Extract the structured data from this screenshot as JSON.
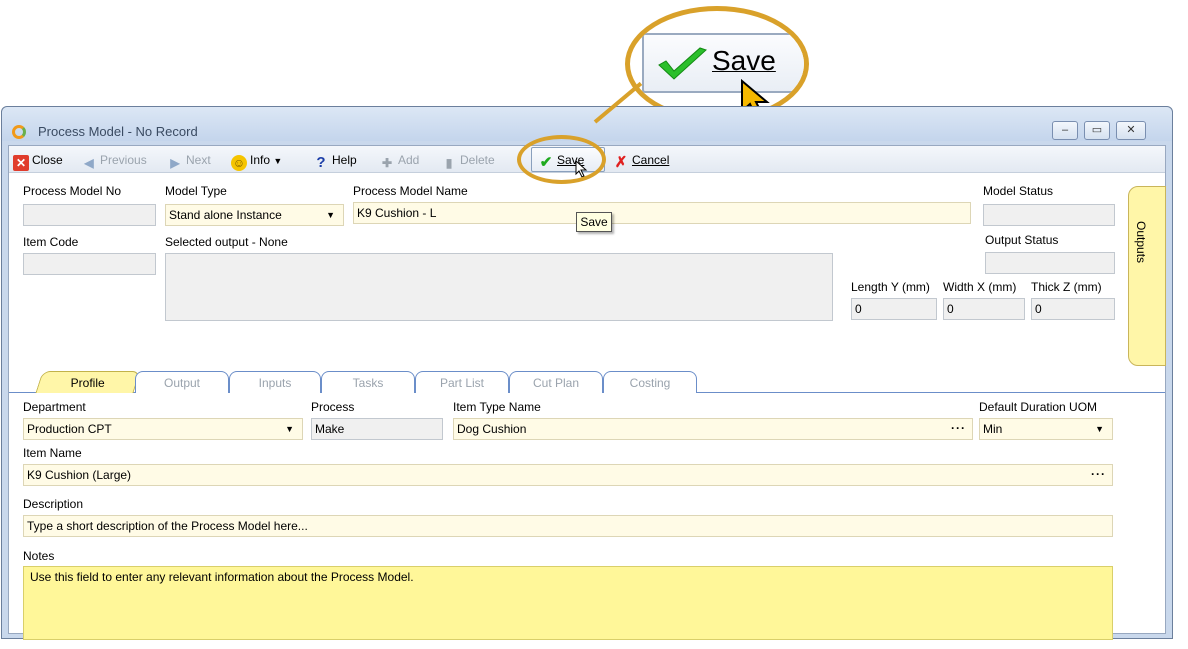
{
  "window": {
    "title": "Process Model - No Record"
  },
  "toolbar": {
    "close": "Close",
    "previous": "Previous",
    "next": "Next",
    "info": "Info",
    "help": "Help",
    "add": "Add",
    "delete": "Delete",
    "save": "Save",
    "cancel": "Cancel"
  },
  "tooltip": "Save",
  "zoom": {
    "label": "Save"
  },
  "header": {
    "process_model_no_label": "Process Model No",
    "process_model_no": "",
    "model_type_label": "Model Type",
    "model_type": "Stand alone Instance",
    "process_model_name_label": "Process Model Name",
    "process_model_name": "K9 Cushion - L",
    "model_status_label": "Model Status",
    "model_status": "",
    "item_code_label": "Item Code",
    "item_code": "",
    "selected_output_label": "Selected output - None",
    "output_status_label": "Output Status",
    "output_status": "",
    "length_label": "Length Y (mm)",
    "length": "0",
    "width_label": "Width X (mm)",
    "width": "0",
    "thick_label": "Thick Z (mm)",
    "thick": "0"
  },
  "side_tab": "Outputs",
  "tabs": [
    "Profile",
    "Output",
    "Inputs",
    "Tasks",
    "Part List",
    "Cut Plan",
    "Costing"
  ],
  "profile": {
    "department_label": "Department",
    "department": "Production CPT",
    "process_label": "Process",
    "process": "Make",
    "item_type_label": "Item Type Name",
    "item_type": "Dog Cushion",
    "duration_label": "Default Duration UOM",
    "duration": "Min",
    "item_name_label": "Item Name",
    "item_name": "K9 Cushion (Large)",
    "description_label": "Description",
    "description": "Type a short description of the Process Model here...",
    "notes_label": "Notes",
    "notes": "Use this field to enter any relevant information about the Process Model."
  },
  "colors": {
    "accent": "#d9a12a",
    "field_yellow": "#fffbe6",
    "notes_yellow": "#fff799",
    "tab_active": "#fff6a8"
  }
}
